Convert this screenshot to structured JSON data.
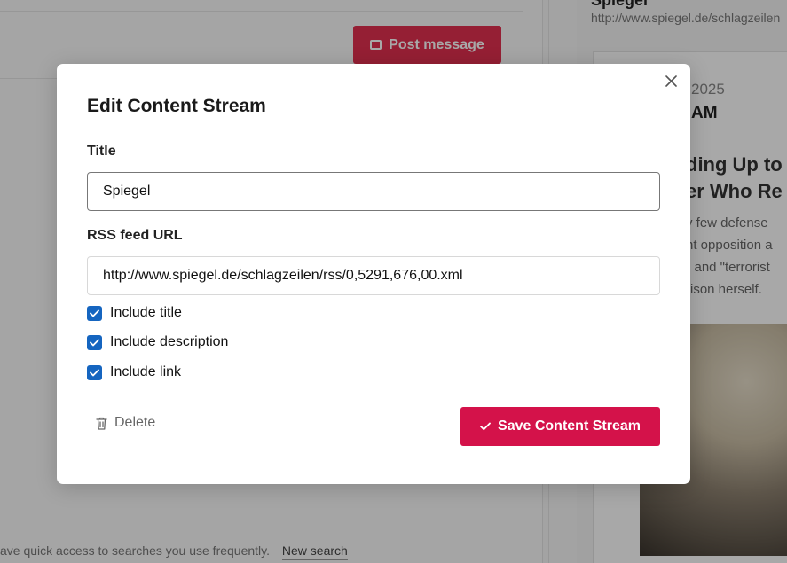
{
  "background": {
    "post_button_label": "Post message",
    "hint_text": "ave quick access to searches you use frequently.",
    "hint_link": "New search",
    "feed_name": "Spiegel",
    "feed_url": "http://www.spiegel.de/schlagzeilen",
    "card": {
      "date": "2025",
      "time": "AM",
      "headline_lines": [
        "ding Up to",
        "er Who Re"
      ],
      "excerpt_lines": [
        "y few defense",
        "nt opposition a",
        "\" and \"terrorist",
        "rison herself."
      ]
    }
  },
  "modal": {
    "title": "Edit Content Stream",
    "title_label": "Title",
    "title_value": "Spiegel",
    "rss_label": "RSS feed URL",
    "rss_value": "http://www.spiegel.de/schlagzeilen/rss/0,5291,676,00.xml",
    "checkboxes": [
      {
        "label": "Include title",
        "checked": true
      },
      {
        "label": "Include description",
        "checked": true
      },
      {
        "label": "Include link",
        "checked": true
      }
    ],
    "delete_label": "Delete",
    "save_label": "Save Content Stream"
  },
  "colors": {
    "accent": "#d4124a",
    "checkbox": "#1565c0",
    "post_button": "#e3304f"
  },
  "icons": {
    "close": "close-icon",
    "delete": "trash-icon",
    "save": "check-icon",
    "post": "message-icon"
  }
}
